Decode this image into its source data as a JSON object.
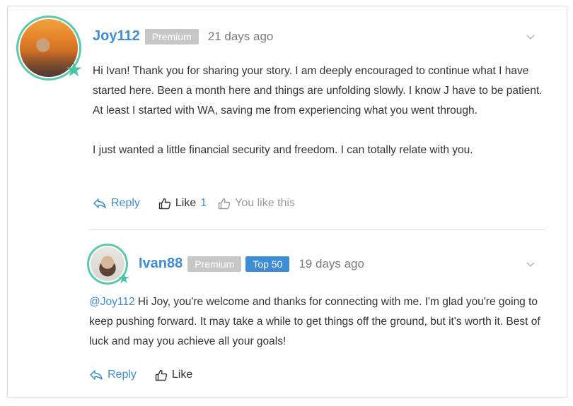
{
  "comments": [
    {
      "username": "Joy112",
      "badges": [
        "Premium"
      ],
      "time_ago": "21 days ago",
      "paragraphs": [
        "Hi Ivan! Thank you for sharing your story. I am deeply encouraged to continue what I have started here. Been a month here and things are unfolding slowly. I know J have to be patient. At least I started with WA, saving me from experiencing what you went through.",
        "I just wanted a little financial security and freedom. I can totally relate with you."
      ],
      "actions": {
        "reply": "Reply",
        "like": "Like",
        "like_count": "1",
        "you_like": "You like this"
      }
    },
    {
      "username": "Ivan88",
      "badges": [
        "Premium",
        "Top 50"
      ],
      "time_ago": "19 days ago",
      "mention": "@Joy112",
      "text": " Hi Joy, you're welcome and thanks for connecting with me. I'm glad you're going to keep pushing forward. It may take a while to get things off the ground, but it's worth it. Best of luck and may you achieve all your goals!",
      "actions": {
        "reply": "Reply",
        "like": "Like"
      }
    }
  ],
  "icons": {
    "reply": "reply-arrow-icon",
    "like": "thumbs-up-icon",
    "menu": "chevron-down-icon",
    "avatar_badge": "star-icon"
  },
  "colors": {
    "accent": "#3c8dd4",
    "avatar_ring": "#5cc9ad",
    "premium_badge": "#c7c7c7",
    "top_badge": "#3d8ed6"
  }
}
